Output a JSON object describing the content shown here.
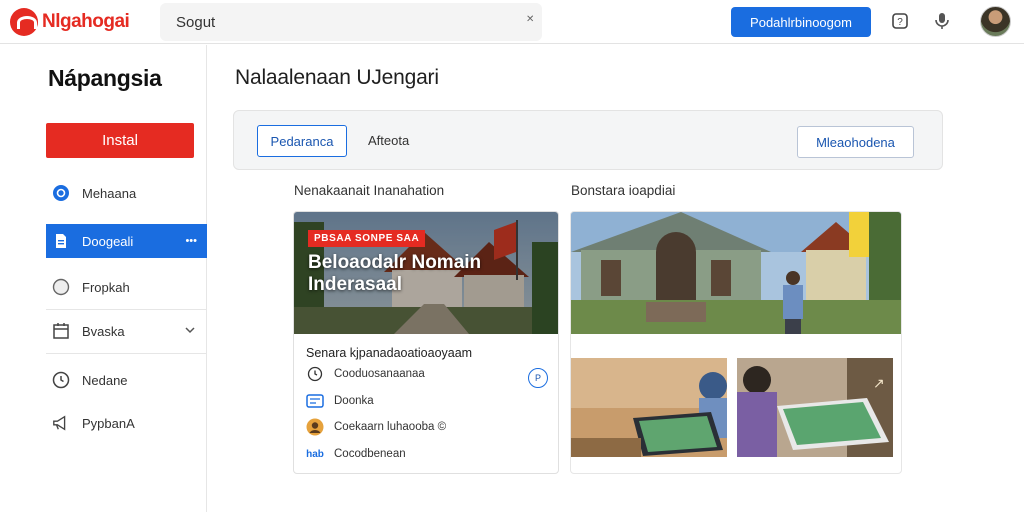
{
  "header": {
    "logo_text": "Nlgahogai",
    "search_placeholder": "Sogut",
    "primary_button": "Podahlrbinoogom"
  },
  "sidebar": {
    "title": "Nápangsia",
    "install_label": "Instal",
    "items": [
      {
        "label": "Mehaana",
        "icon": "circle-dot-icon"
      },
      {
        "label": "Doogeali",
        "icon": "document-icon",
        "active": true,
        "extra": "•••"
      },
      {
        "label": "Fropkah",
        "icon": "circle-icon"
      },
      {
        "label": "Bvaska",
        "icon": "calendar-icon",
        "extra": "chevron-down"
      },
      {
        "label": "Nedane",
        "icon": "clock-icon"
      },
      {
        "label": "PypbanA",
        "icon": "megaphone-icon"
      }
    ]
  },
  "main": {
    "title": "Nalaalenaan UJengari",
    "tabs": {
      "selected": "Pedaranca",
      "other": "Afteota"
    },
    "action_button": "Mleaohodena",
    "left_section_label": "Nenakaanait Inanahation",
    "right_section_label": "Bonstara ioapdiai",
    "card": {
      "tag": "PBSAA SONPE SAA",
      "hero_title": "Beloaodalr Nomain Inderasaal",
      "heading": "Senara kjpanadaoatioaoyaam",
      "rows": [
        {
          "label": "Cooduosanaanaa",
          "icon": "clock-icon"
        },
        {
          "label": "Doonka",
          "icon": "card-icon"
        },
        {
          "label": "Coekaarn luhaooba ©",
          "icon": "avatar-icon"
        },
        {
          "label": "Cocodbenean",
          "icon": "code-icon",
          "prefix": "hab"
        }
      ],
      "action_glyph": "P"
    }
  },
  "colors": {
    "brand_red": "#e52b22",
    "accent_blue": "#1a6de0"
  }
}
